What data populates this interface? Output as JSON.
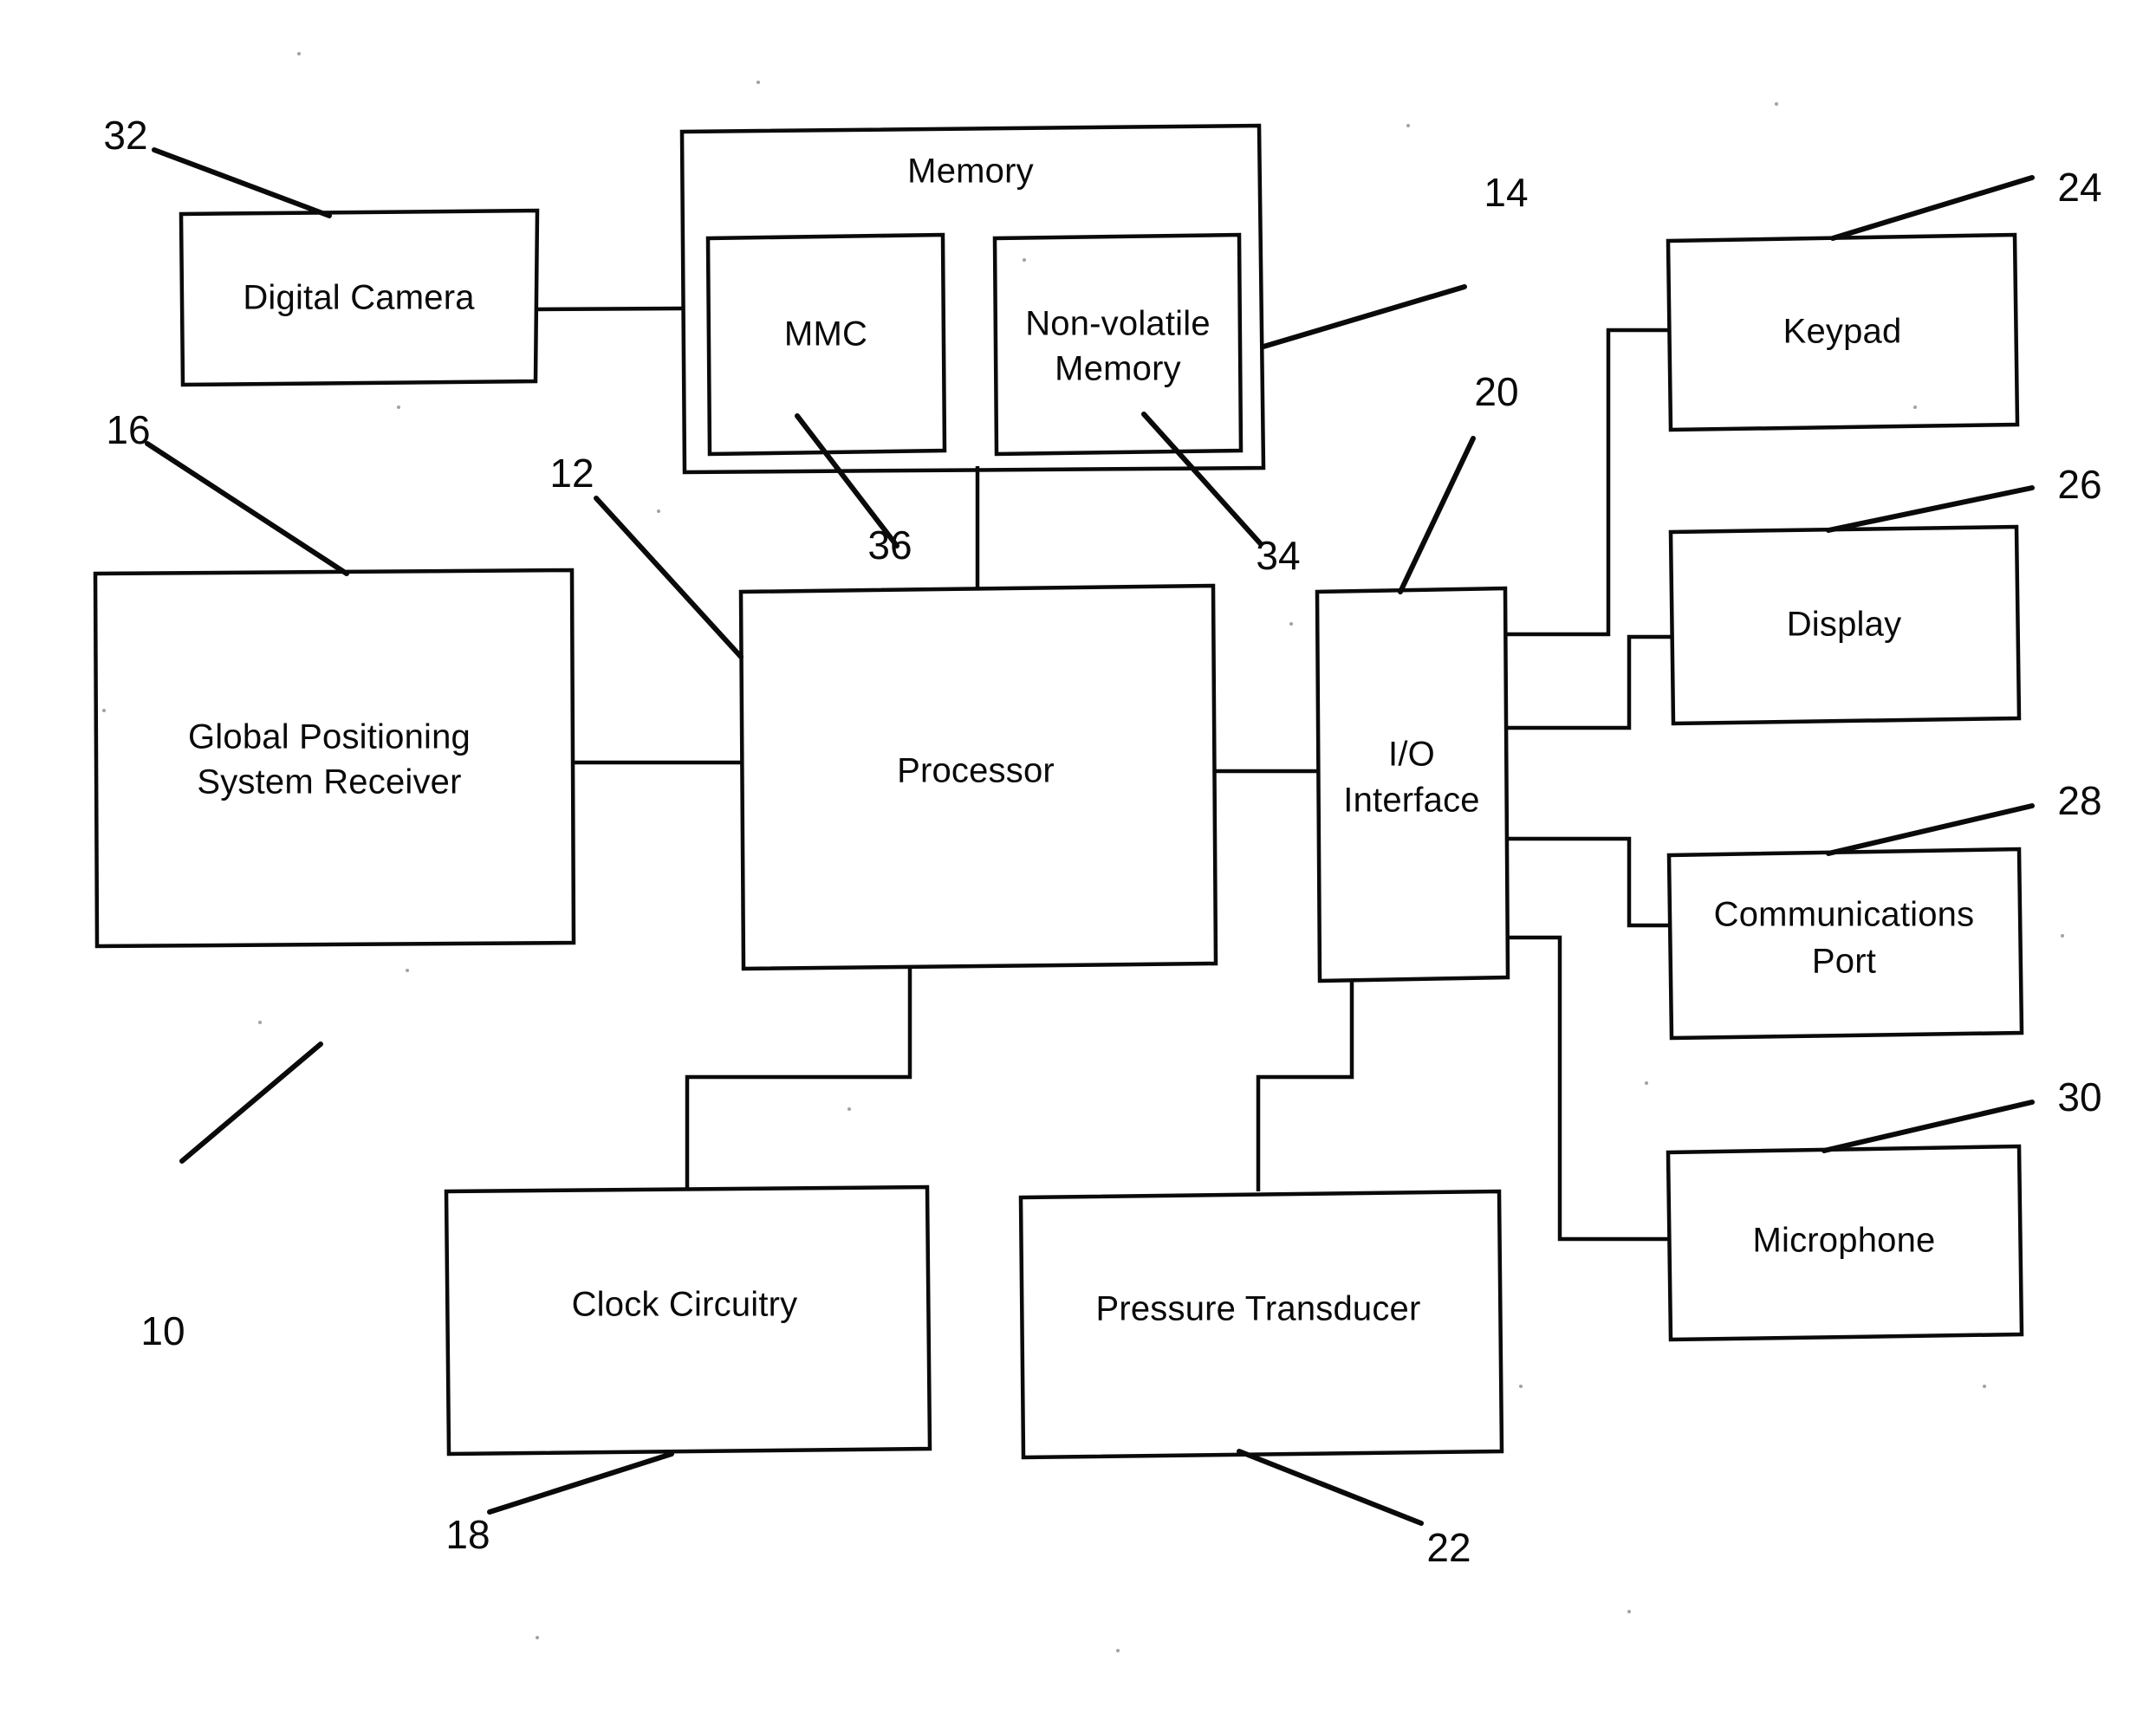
{
  "figure": {
    "title": "Block diagram of portable electronic device",
    "background_color": "#ffffff",
    "line_color": "#0a0a0a"
  },
  "blocks": [
    {
      "id": "digital_camera",
      "label": "Digital Camera",
      "ref": "32"
    },
    {
      "id": "memory",
      "label": "Memory",
      "ref": "14"
    },
    {
      "id": "mmc",
      "label": "MMC",
      "ref": "36"
    },
    {
      "id": "nonvolatile",
      "label_line1": "Non-volatile",
      "label_line2": "Memory",
      "ref": "34"
    },
    {
      "id": "gps",
      "label_line1": "Global Positioning",
      "label_line2": "System Receiver",
      "ref": "16"
    },
    {
      "id": "processor",
      "label": "Processor",
      "ref": "12"
    },
    {
      "id": "io_interface",
      "label_line1": "I/O",
      "label_line2": "Interface",
      "ref": "20"
    },
    {
      "id": "keypad",
      "label": "Keypad",
      "ref": "24"
    },
    {
      "id": "display",
      "label": "Display",
      "ref": "26"
    },
    {
      "id": "comm_port",
      "label_line1": "Communications",
      "label_line2": "Port",
      "ref": "28"
    },
    {
      "id": "microphone",
      "label": "Microphone",
      "ref": "30"
    },
    {
      "id": "clock",
      "label": "Clock Circuitry",
      "ref": "18"
    },
    {
      "id": "pressure",
      "label": "Pressure Transducer",
      "ref": "22"
    }
  ],
  "reference_numerals": {
    "system": "10",
    "processor": "12",
    "memory": "14",
    "gps": "16",
    "clock": "18",
    "io_interface": "20",
    "pressure": "22",
    "keypad": "24",
    "display": "26",
    "comm_port": "28",
    "microphone": "30",
    "digital_camera": "32",
    "nonvolatile": "34",
    "mmc": "36"
  },
  "labels": {
    "digital_camera": "Digital Camera",
    "memory": "Memory",
    "mmc": "MMC",
    "nonvolatile_l1": "Non-volatile",
    "nonvolatile_l2": "Memory",
    "gps_l1": "Global Positioning",
    "gps_l2": "System Receiver",
    "processor": "Processor",
    "io_l1": "I/O",
    "io_l2": "Interface",
    "keypad": "Keypad",
    "display": "Display",
    "comm_l1": "Communications",
    "comm_l2": "Port",
    "microphone": "Microphone",
    "clock": "Clock Circuitry",
    "pressure": "Pressure Transducer"
  },
  "connections": [
    {
      "from": "digital_camera",
      "to": "memory"
    },
    {
      "from": "memory",
      "to": "processor"
    },
    {
      "from": "gps",
      "to": "processor"
    },
    {
      "from": "processor",
      "to": "io_interface"
    },
    {
      "from": "processor",
      "to": "clock"
    },
    {
      "from": "io_interface",
      "to": "pressure"
    },
    {
      "from": "io_interface",
      "to": "keypad"
    },
    {
      "from": "io_interface",
      "to": "display"
    },
    {
      "from": "io_interface",
      "to": "comm_port"
    },
    {
      "from": "io_interface",
      "to": "microphone"
    }
  ]
}
